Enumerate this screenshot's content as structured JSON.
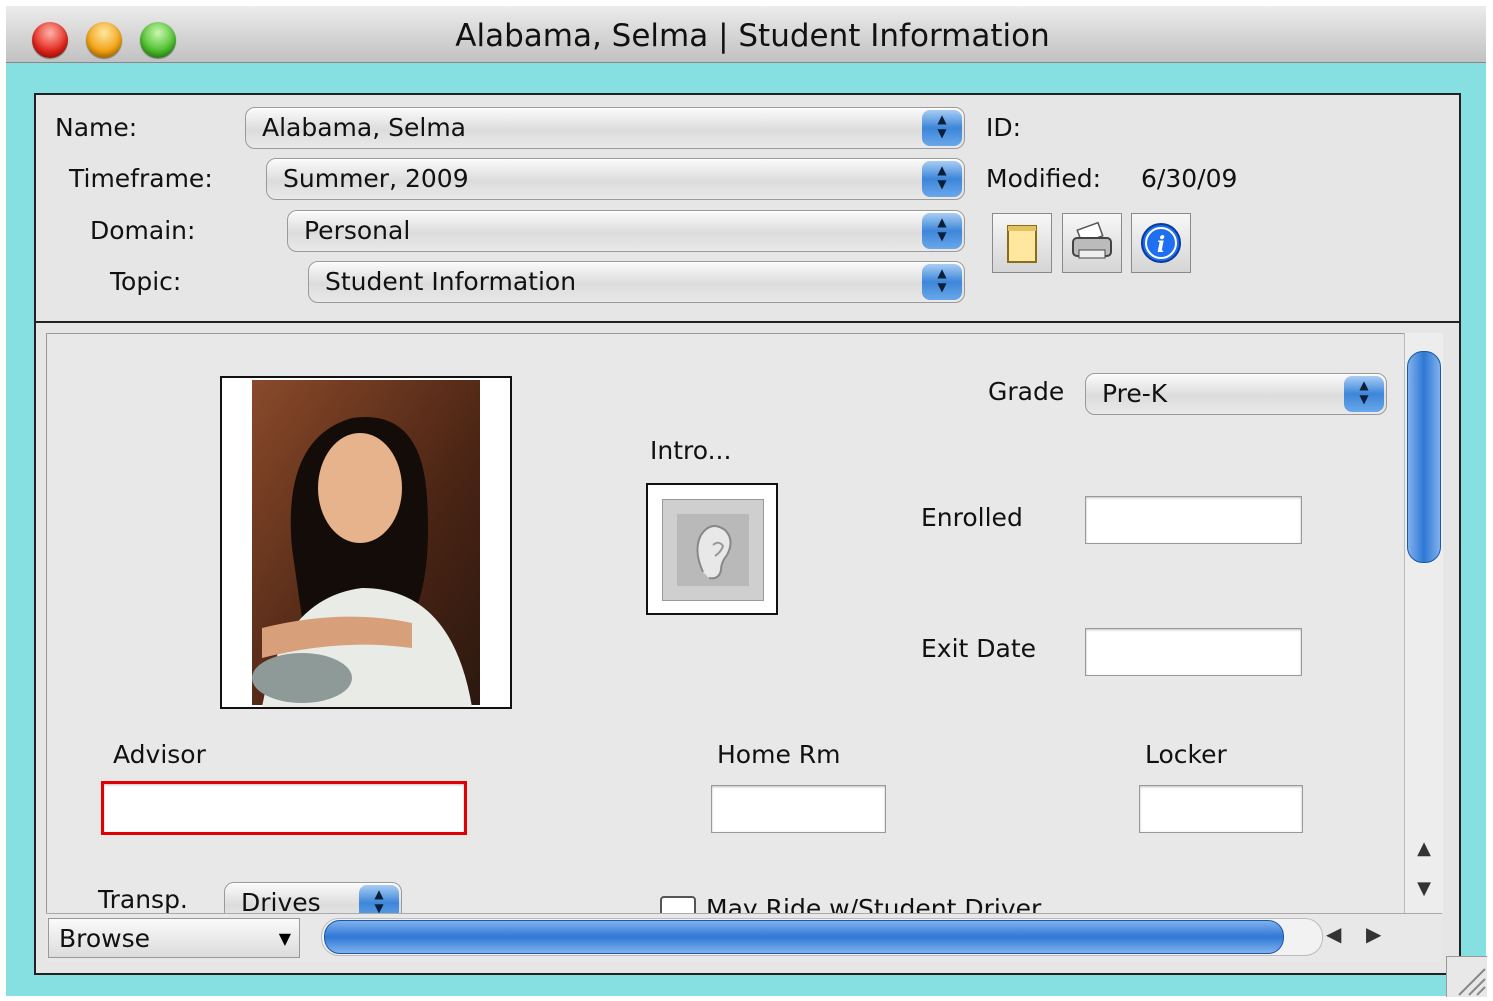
{
  "window": {
    "title": "Alabama, Selma | Student Information"
  },
  "header": {
    "name_label": "Name:",
    "name_value": "Alabama, Selma",
    "timeframe_label": "Timeframe:",
    "timeframe_value": "Summer, 2009",
    "domain_label": "Domain:",
    "domain_value": "Personal",
    "topic_label": "Topic:",
    "topic_value": "Student Information",
    "id_label": "ID:",
    "modified_label": "Modified:",
    "modified_value": "6/30/09"
  },
  "toolbar": {
    "icons": [
      "notepad-icon",
      "printer-icon",
      "info-icon"
    ]
  },
  "form": {
    "grade_label": "Grade",
    "grade_value": "Pre-K",
    "intro_label": "Intro...",
    "enrolled_label": "Enrolled",
    "enrolled_value": "",
    "exit_date_label": "Exit Date",
    "exit_date_value": "",
    "advisor_label": "Advisor",
    "advisor_value": "",
    "home_rm_label": "Home Rm",
    "home_rm_value": "",
    "locker_label": "Locker",
    "locker_value": "",
    "transp_label": "Transp.",
    "transp_value": "Drives",
    "may_ride_label": "May Ride w/Student Driver"
  },
  "status": {
    "mode_value": "Browse"
  },
  "colors": {
    "window_bg": "#86e0e2",
    "advisor_border": "#e00000",
    "scroll_blue": "#3d86d9"
  }
}
